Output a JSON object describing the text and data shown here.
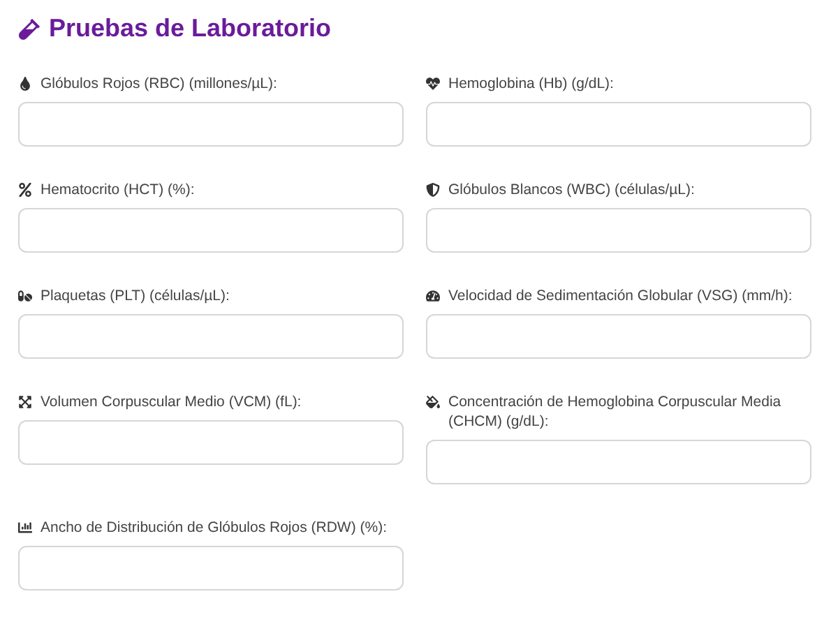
{
  "title": "Pruebas de Laboratorio",
  "fields": [
    {
      "label": "Glóbulos Rojos (RBC) (millones/µL):"
    },
    {
      "label": "Hemoglobina (Hb) (g/dL):"
    },
    {
      "label": "Hematocrito (HCT) (%):"
    },
    {
      "label": "Glóbulos Blancos (WBC) (células/µL):"
    },
    {
      "label": "Plaquetas (PLT) (células/µL):"
    },
    {
      "label": "Velocidad de Sedimentación Globular (VSG) (mm/h):"
    },
    {
      "label": "Volumen Corpuscular Medio (VCM) (fL):"
    },
    {
      "label": "Concentración de Hemoglobina Corpuscular Media (CHCM) (g/dL):"
    },
    {
      "label": "Ancho de Distribución de Glóbulos Rojos (RDW) (%):"
    }
  ]
}
